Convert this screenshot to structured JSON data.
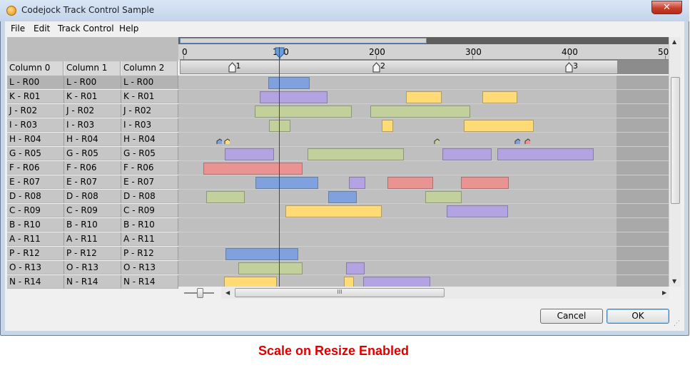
{
  "window": {
    "title": "Codejock Track Control Sample",
    "close_glyph": "✕"
  },
  "menu": [
    "File",
    "Edit",
    "Track Control",
    "Help"
  ],
  "columns": [
    "Column 0",
    "Column 1",
    "Column 2"
  ],
  "rows": [
    [
      "L - R00",
      "L - R00",
      "L - R00"
    ],
    [
      "K - R01",
      "K - R01",
      "K - R01"
    ],
    [
      "J - R02",
      "J - R02",
      "J - R02"
    ],
    [
      "I - R03",
      "I - R03",
      "I - R03"
    ],
    [
      "H - R04",
      "H - R04",
      "H - R04"
    ],
    [
      "G - R05",
      "G - R05",
      "G - R05"
    ],
    [
      "F - R06",
      "F - R06",
      "F - R06"
    ],
    [
      "E - R07",
      "E - R07",
      "E - R07"
    ],
    [
      "D - R08",
      "D - R08",
      "D - R08"
    ],
    [
      "C - R09",
      "C - R09",
      "C - R09"
    ],
    [
      "B - R10",
      "B - R10",
      "B - R10"
    ],
    [
      "A - R11",
      "A - R11",
      "A - R11"
    ],
    [
      "P - R12",
      "P - R12",
      "P - R12"
    ],
    [
      "O - R13",
      "O - R13",
      "O - R13"
    ],
    [
      "N - R14",
      "N - R14",
      "N - R14"
    ]
  ],
  "ruler": {
    "ticks": [
      "0",
      "100",
      "200",
      "300",
      "400",
      "500"
    ],
    "position": 100,
    "markers": [
      "1",
      "2",
      "3"
    ]
  },
  "colors": {
    "blue": "#7fa2df",
    "purple": "#b3a3e3",
    "yellow": "#ffdb76",
    "green": "#c2d09c",
    "red": "#ea9393",
    "timeline_marker": "#c01414"
  },
  "blocks": [
    {
      "row": 0,
      "start": 88,
      "end": 131,
      "color": "blue"
    },
    {
      "row": 1,
      "start": 79,
      "end": 150,
      "color": "purple"
    },
    {
      "row": 1,
      "start": 231,
      "end": 268,
      "color": "yellow"
    },
    {
      "row": 1,
      "start": 310,
      "end": 347,
      "color": "yellow"
    },
    {
      "row": 2,
      "start": 74,
      "end": 175,
      "color": "green"
    },
    {
      "row": 2,
      "start": 194,
      "end": 298,
      "color": "green"
    },
    {
      "row": 3,
      "start": 89,
      "end": 111,
      "color": "green"
    },
    {
      "row": 3,
      "start": 206,
      "end": 218,
      "color": "yellow"
    },
    {
      "row": 3,
      "start": 291,
      "end": 364,
      "color": "yellow"
    },
    {
      "row": 5,
      "start": 43,
      "end": 94,
      "color": "purple"
    },
    {
      "row": 5,
      "start": 129,
      "end": 229,
      "color": "green"
    },
    {
      "row": 5,
      "start": 269,
      "end": 320,
      "color": "purple"
    },
    {
      "row": 5,
      "start": 326,
      "end": 426,
      "color": "purple"
    },
    {
      "row": 6,
      "start": 21,
      "end": 124,
      "color": "red"
    },
    {
      "row": 7,
      "start": 75,
      "end": 140,
      "color": "blue"
    },
    {
      "row": 7,
      "start": 172,
      "end": 189,
      "color": "purple"
    },
    {
      "row": 7,
      "start": 212,
      "end": 259,
      "color": "red"
    },
    {
      "row": 7,
      "start": 288,
      "end": 338,
      "color": "red"
    },
    {
      "row": 8,
      "start": 24,
      "end": 64,
      "color": "green"
    },
    {
      "row": 8,
      "start": 150,
      "end": 180,
      "color": "blue"
    },
    {
      "row": 8,
      "start": 251,
      "end": 289,
      "color": "green"
    },
    {
      "row": 9,
      "start": 106,
      "end": 206,
      "color": "yellow"
    },
    {
      "row": 9,
      "start": 273,
      "end": 337,
      "color": "purple"
    },
    {
      "row": 12,
      "start": 44,
      "end": 119,
      "color": "blue"
    },
    {
      "row": 13,
      "start": 57,
      "end": 124,
      "color": "green"
    },
    {
      "row": 13,
      "start": 169,
      "end": 188,
      "color": "purple"
    },
    {
      "row": 14,
      "start": 42,
      "end": 97,
      "color": "yellow"
    },
    {
      "row": 14,
      "start": 167,
      "end": 177,
      "color": "yellow"
    },
    {
      "row": 14,
      "start": 187,
      "end": 256,
      "color": "purple"
    }
  ],
  "row_markers": [
    {
      "row": 4,
      "pos": 37,
      "color": "blue"
    },
    {
      "row": 4,
      "pos": 45,
      "color": "yellow"
    },
    {
      "row": 4,
      "pos": 263,
      "color": "green"
    },
    {
      "row": 4,
      "pos": 347,
      "color": "blue"
    },
    {
      "row": 4,
      "pos": 357,
      "color": "red"
    }
  ],
  "buttons": {
    "cancel": "Cancel",
    "ok": "OK"
  },
  "hscroll_grip": "III",
  "caption": "Scale on Resize Enabled"
}
